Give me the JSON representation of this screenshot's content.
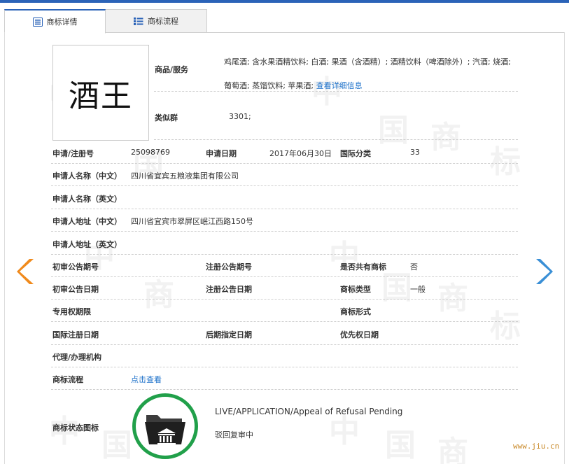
{
  "tabs": [
    {
      "label": "商标详情",
      "icon": "list-detail-icon",
      "active": true
    },
    {
      "label": "商标流程",
      "icon": "list-bullets-icon",
      "active": false
    }
  ],
  "logo": {
    "text": "酒王"
  },
  "goods": {
    "label": "商品/服务",
    "value": "鸡尾酒; 含水果酒精饮料; 白酒; 果酒（含酒精）; 酒精饮料（啤酒除外）; 汽酒; 烧酒; 葡萄酒; 蒸馏饮料; 苹果酒;",
    "more_link": "查看详细信息"
  },
  "similar_group": {
    "label": "类似群",
    "value": "3301;"
  },
  "fields": {
    "reg_no": {
      "label": "申请/注册号",
      "value": "25098769"
    },
    "apply_date": {
      "label": "申请日期",
      "value": "2017年06月30日"
    },
    "intl_class": {
      "label": "国际分类",
      "value": "33"
    },
    "applicant_cn": {
      "label": "申请人名称（中文）",
      "value": "四川省宜宾五粮液集团有限公司"
    },
    "applicant_en": {
      "label": "申请人名称（英文）",
      "value": ""
    },
    "address_cn": {
      "label": "申请人地址（中文）",
      "value": "四川省宜宾市翠屏区岷江西路150号"
    },
    "address_en": {
      "label": "申请人地址（英文）",
      "value": ""
    },
    "prelim_issue": {
      "label": "初审公告期号",
      "value": ""
    },
    "reg_issue": {
      "label": "注册公告期号",
      "value": ""
    },
    "shared": {
      "label": "是否共有商标",
      "value": "否"
    },
    "prelim_date": {
      "label": "初审公告日期",
      "value": ""
    },
    "reg_date": {
      "label": "注册公告日期",
      "value": ""
    },
    "tm_type": {
      "label": "商标类型",
      "value": "一般"
    },
    "exclusive_period": {
      "label": "专用权期限",
      "value": ""
    },
    "tm_form": {
      "label": "商标形式",
      "value": ""
    },
    "intl_reg_date": {
      "label": "国际注册日期",
      "value": ""
    },
    "later_date": {
      "label": "后期指定日期",
      "value": ""
    },
    "priority_date": {
      "label": "优先权日期",
      "value": ""
    },
    "agent": {
      "label": "代理/办理机构",
      "value": ""
    },
    "process": {
      "label": "商标流程",
      "link": "点击查看"
    }
  },
  "status": {
    "label": "商标状态图标",
    "en": "LIVE/APPLICATION/Appeal of Refusal Pending",
    "cn": "驳回复审中",
    "icon": "folder-courthouse-icon",
    "ring_color": "#21a04a"
  },
  "watermark": {
    "text": [
      "中",
      "国",
      "商",
      "标"
    ],
    "site": "www.jiu.cn"
  },
  "colors": {
    "accent": "#2b63b8",
    "link": "#1a6fc9",
    "prev_arrow": "#f08a1c",
    "next_arrow": "#3a8fd6"
  }
}
